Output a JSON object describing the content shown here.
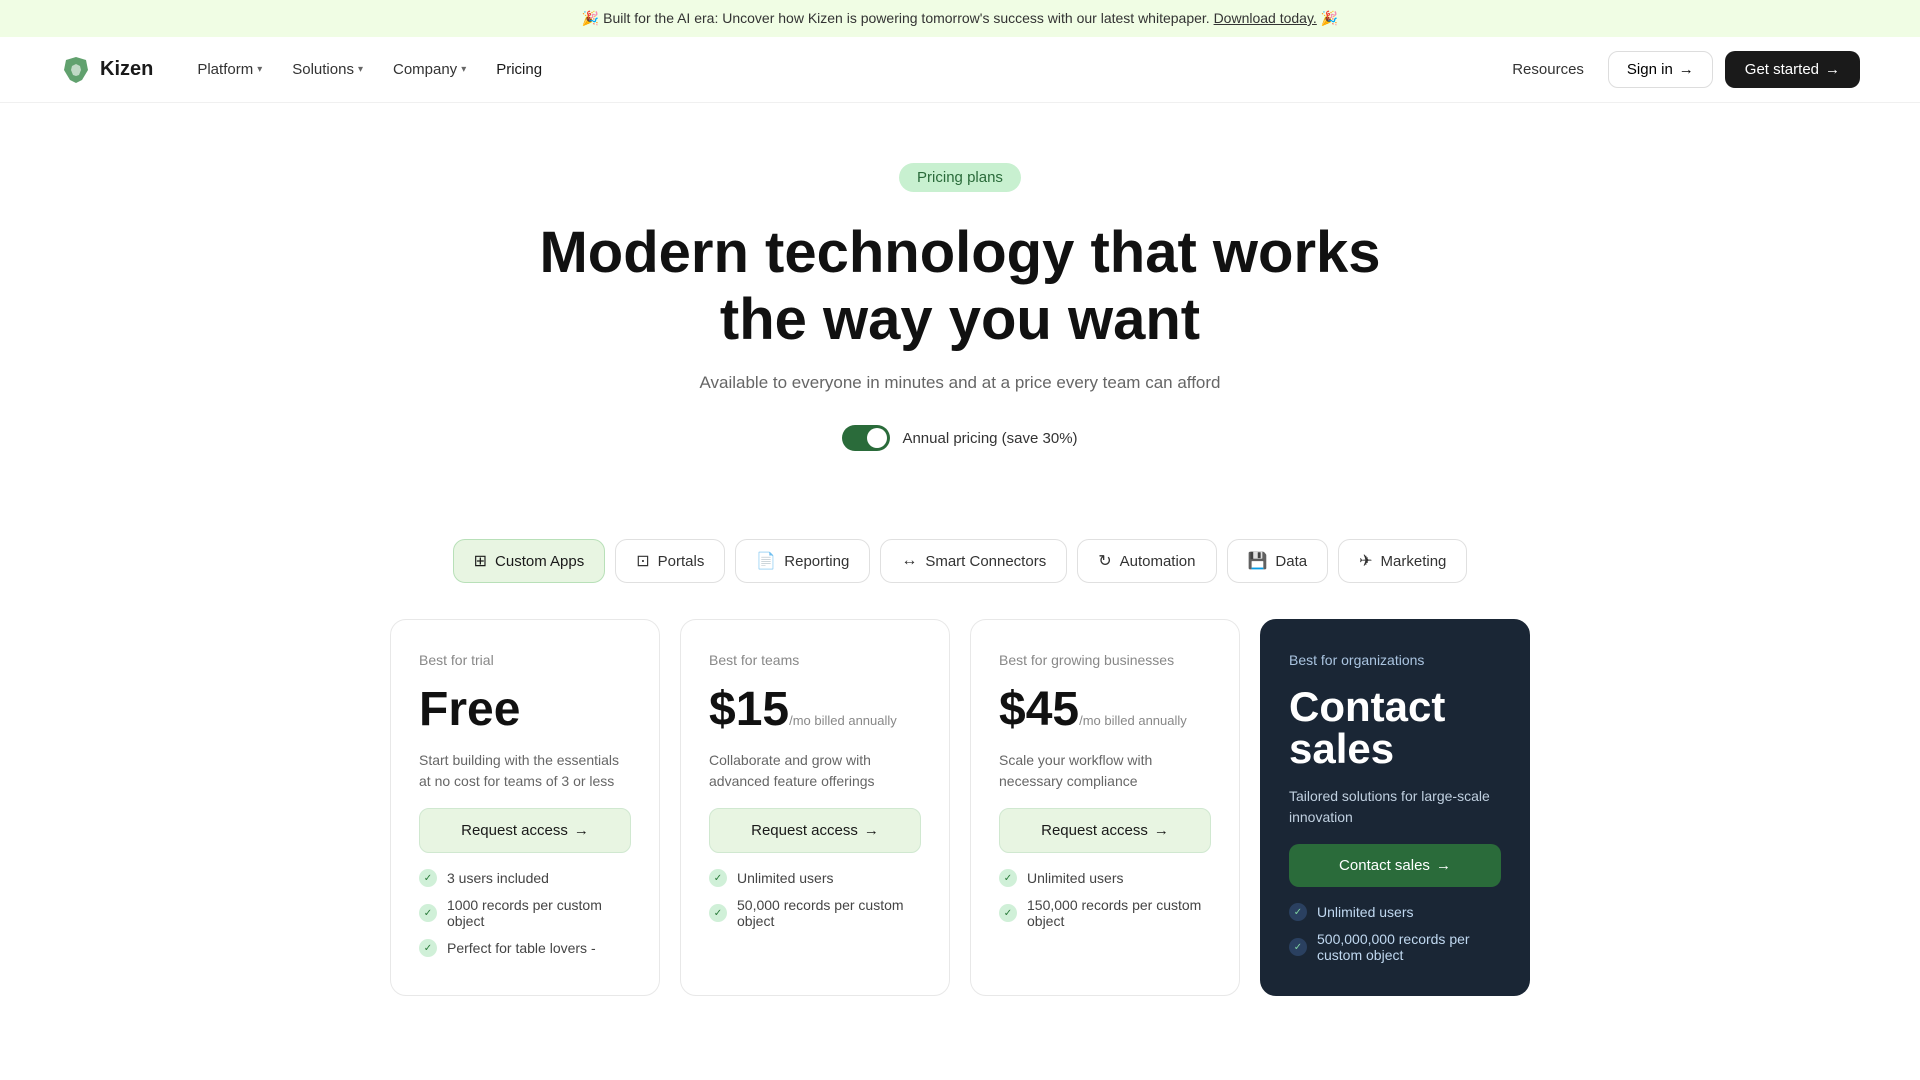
{
  "banner": {
    "text": "🎉 Built for the AI era: Uncover how Kizen is powering tomorrow's success with our latest whitepaper.",
    "link_text": "Download today.",
    "link_emoji": "🎉"
  },
  "nav": {
    "logo_text": "Kizen",
    "links": [
      {
        "id": "platform",
        "label": "Platform",
        "has_dropdown": true
      },
      {
        "id": "solutions",
        "label": "Solutions",
        "has_dropdown": true
      },
      {
        "id": "company",
        "label": "Company",
        "has_dropdown": true
      },
      {
        "id": "pricing",
        "label": "Pricing",
        "has_dropdown": false
      }
    ],
    "resources_label": "Resources",
    "signin_label": "Sign in",
    "getstarted_label": "Get started"
  },
  "hero": {
    "badge": "Pricing plans",
    "heading_line1": "Modern technology that works",
    "heading_line2": "the way you want",
    "subheading": "Available to everyone in minutes and at a price every team can afford",
    "toggle_label": "Annual pricing (save 30%)"
  },
  "feature_tabs": [
    {
      "id": "custom-apps",
      "label": "Custom Apps",
      "icon": "⊞",
      "active": true
    },
    {
      "id": "portals",
      "label": "Portals",
      "icon": "⊡",
      "active": false
    },
    {
      "id": "reporting",
      "label": "Reporting",
      "icon": "📄",
      "active": false
    },
    {
      "id": "smart-connectors",
      "label": "Smart Connectors",
      "icon": "↔",
      "active": false
    },
    {
      "id": "automation",
      "label": "Automation",
      "icon": "↻",
      "active": false
    },
    {
      "id": "data",
      "label": "Data",
      "icon": "💾",
      "active": false
    },
    {
      "id": "marketing",
      "label": "Marketing",
      "icon": "✈",
      "active": false
    }
  ],
  "plans": [
    {
      "id": "free",
      "tier": "Best for trial",
      "price": "Free",
      "price_suffix": "",
      "description": "Start building with the essentials at no cost for teams of 3 or less",
      "button_label": "Request access",
      "dark": false,
      "features": [
        "3 users included",
        "1000 records per custom object",
        "Perfect for table lovers -"
      ]
    },
    {
      "id": "teams",
      "tier": "Best for teams",
      "price": "$15",
      "price_suffix": "/mo billed annually",
      "description": "Collaborate and grow with advanced feature offerings",
      "button_label": "Request access",
      "dark": false,
      "features": [
        "Unlimited users",
        "50,000 records per custom object"
      ]
    },
    {
      "id": "growing",
      "tier": "Best for growing businesses",
      "price": "$45",
      "price_suffix": "/mo billed annually",
      "description": "Scale your workflow with necessary compliance",
      "button_label": "Request access",
      "dark": false,
      "features": [
        "Unlimited users",
        "150,000 records per custom object"
      ]
    },
    {
      "id": "enterprise",
      "tier": "Best for organizations",
      "price": "Contact sales",
      "price_suffix": "",
      "description": "Tailored solutions for large-scale innovation",
      "button_label": "Contact sales",
      "dark": true,
      "features": [
        "Unlimited users",
        "500,000,000 records per custom object"
      ]
    }
  ]
}
